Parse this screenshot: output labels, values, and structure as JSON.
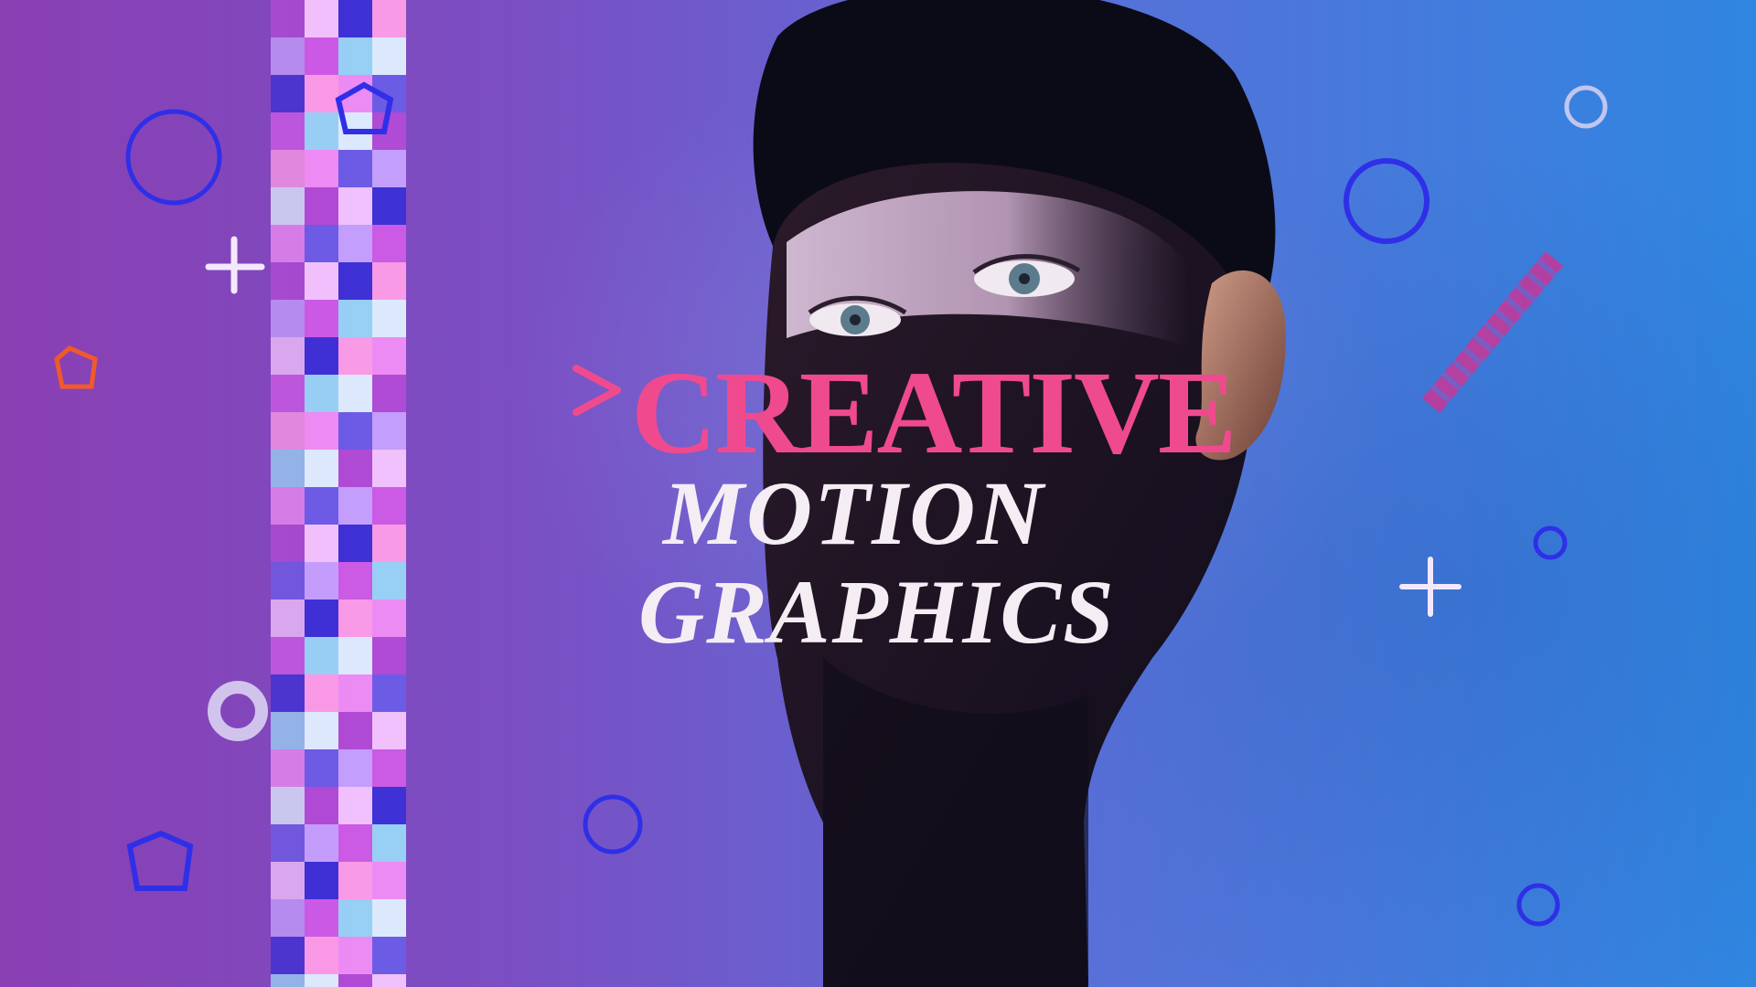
{
  "title": {
    "line1": "CREATIVE",
    "line2": "MOTION",
    "line3": "GRAPHICS"
  },
  "colors": {
    "accent_pink": "#f04a8e",
    "title_white": "#f4eef4",
    "shape_blue": "#2f2fe8",
    "shape_orange": "#f05a2a",
    "shape_white": "#f3e9ff"
  },
  "decorations": [
    "circle-outline-icon",
    "plus-icon",
    "pentagon-outline-icon",
    "ring-icon",
    "stripe-bar-icon",
    "chevron-right-icon",
    "pixel-strip"
  ]
}
